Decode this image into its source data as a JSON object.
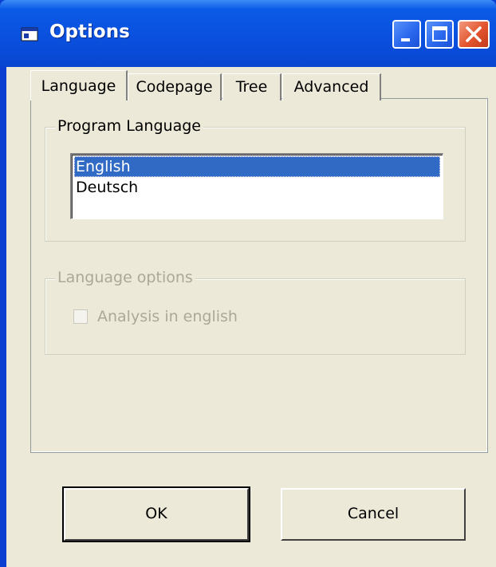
{
  "window": {
    "title": "Options"
  },
  "tabs": [
    {
      "label": "Language",
      "active": true
    },
    {
      "label": "Codepage",
      "active": false
    },
    {
      "label": "Tree",
      "active": false
    },
    {
      "label": "Advanced",
      "active": false
    }
  ],
  "program_language": {
    "legend": "Program Language",
    "items": [
      {
        "label": "English",
        "selected": true
      },
      {
        "label": "Deutsch",
        "selected": false
      }
    ]
  },
  "language_options": {
    "legend": "Language options",
    "checkbox_label": "Analysis in english",
    "checked": false,
    "enabled": false
  },
  "buttons": {
    "ok": "OK",
    "cancel": "Cancel"
  },
  "colors": {
    "titlebar": "#0a4fde",
    "selection": "#316ac5",
    "face": "#ece9d8",
    "close_button": "#e2542e",
    "disabled_text": "#aca899"
  },
  "icons": {
    "title": "window-app-icon",
    "minimize": "minimize-icon",
    "maximize": "maximize-icon",
    "close": "close-icon"
  }
}
